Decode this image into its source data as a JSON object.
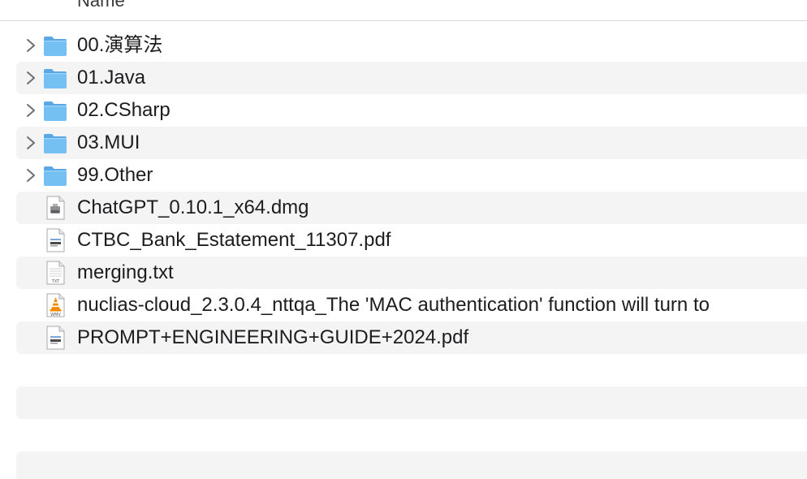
{
  "header": {
    "name_column": "Name"
  },
  "rows": [
    {
      "label": "00.演算法",
      "kind": "folder",
      "icon": "folder-icon",
      "expandable": true
    },
    {
      "label": "01.Java",
      "kind": "folder",
      "icon": "folder-icon",
      "expandable": true
    },
    {
      "label": "02.CSharp",
      "kind": "folder",
      "icon": "folder-icon",
      "expandable": true
    },
    {
      "label": "03.MUI",
      "kind": "folder",
      "icon": "folder-icon",
      "expandable": true
    },
    {
      "label": "99.Other",
      "kind": "folder",
      "icon": "folder-icon",
      "expandable": true
    },
    {
      "label": "ChatGPT_0.10.1_x64.dmg",
      "kind": "file",
      "icon": "disk-image-icon",
      "expandable": false
    },
    {
      "label": "CTBC_Bank_Estatement_11307.pdf",
      "kind": "file",
      "icon": "pdf-file-icon",
      "expandable": false
    },
    {
      "label": "merging.txt",
      "kind": "file",
      "icon": "text-file-icon",
      "expandable": false,
      "icon_text": "TXT"
    },
    {
      "label": "nuclias-cloud_2.3.0.4_nttqa_The 'MAC authentication' function will turn to",
      "kind": "file",
      "icon": "vlc-video-file-icon",
      "expandable": false,
      "icon_text": "WMV"
    },
    {
      "label": "PROMPT+ENGINEERING+GUIDE+2024.pdf",
      "kind": "file",
      "icon": "pdf-file-icon",
      "expandable": false
    }
  ],
  "colors": {
    "folder_front": "#74c0f2",
    "folder_back": "#5aa9e6",
    "stripe": "#f4f4f5",
    "vlc_orange": "#f08a00"
  }
}
